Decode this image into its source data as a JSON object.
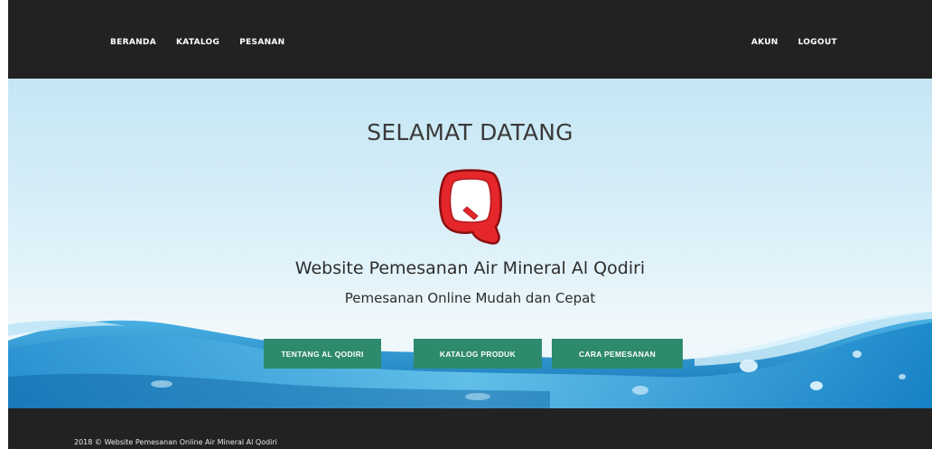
{
  "nav": {
    "left": [
      "BERANDA",
      "KATALOG",
      "PESANAN"
    ],
    "right": [
      "AKUN",
      "LOGOUT"
    ]
  },
  "hero": {
    "title": "SELAMAT DATANG",
    "subtitle": "Website Pemesanan Air Mineral Al Qodiri",
    "tagline": "Pemesanan Online Mudah dan Cepat",
    "buttons": [
      "TENTANG AL QODIRI",
      "KATALOG PRODUK",
      "CARA PEMESANAN"
    ]
  },
  "logo": {
    "icon": "q-logo-icon",
    "color": "#e5262b"
  },
  "colors": {
    "nav_bg": "#222222",
    "button_bg": "#2e8a6c",
    "footer_bg": "#222222"
  },
  "footer": {
    "text": "2018 © Website Pemesanan Online Air Mineral Al Qodiri"
  }
}
